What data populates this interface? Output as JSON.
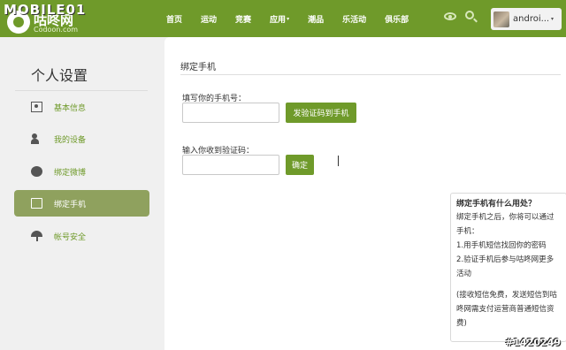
{
  "watermark": {
    "top": "MOBILE01",
    "bottom": "#1420249"
  },
  "logo": {
    "cn": "咕咚网",
    "en": "Codoon.com"
  },
  "nav": [
    {
      "label": "首页"
    },
    {
      "label": "运动"
    },
    {
      "label": "竞赛"
    },
    {
      "label": "应用",
      "caret": "▾"
    },
    {
      "label": "潮品"
    },
    {
      "label": "乐活动"
    },
    {
      "label": "俱乐部"
    }
  ],
  "header": {
    "icons": [
      "eye-icon",
      "search-icon"
    ],
    "username": "androi...",
    "caret": "▾"
  },
  "sidebar": {
    "title": "个人设置",
    "items": [
      {
        "label": "基本信息",
        "icon": "profile-card-icon"
      },
      {
        "label": "我的设备",
        "icon": "user-device-icon"
      },
      {
        "label": "绑定微博",
        "icon": "weibo-icon"
      },
      {
        "label": "绑定手机",
        "icon": "phone-icon",
        "active": true
      },
      {
        "label": "帐号安全",
        "icon": "umbrella-icon"
      }
    ]
  },
  "main": {
    "title": "绑定手机",
    "phone_label": "填写你的手机号：",
    "phone_value": "",
    "send_code_button": "发验证码到手机",
    "code_label": "输入你收到验证码：",
    "code_value": "",
    "confirm_button": "确定"
  },
  "info": {
    "title": "绑定手机有什么用处？",
    "lines": [
      "绑定手机之后，你将可以通过手机：",
      "1.用手机短信找回你的密码",
      "2.验证手机后参与咕咚网更多活动"
    ],
    "note": "(接收短信免费，发送短信到咕咚网需支付运营商普通短信资费)"
  },
  "colors": {
    "brand": "#6f9a2a",
    "active_sidebar": "#8fa15e"
  }
}
